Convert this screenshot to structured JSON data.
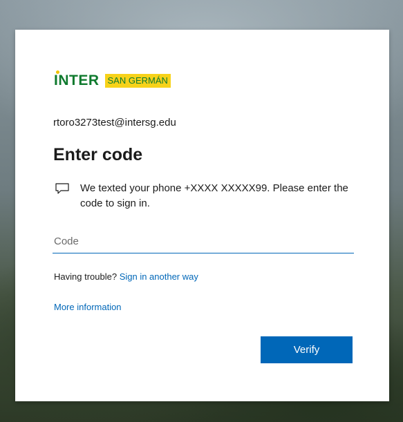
{
  "logo": {
    "brand": "INTER",
    "campus": "SAN GERMÁN"
  },
  "account": {
    "email": "rtoro3273test@intersg.edu"
  },
  "heading": "Enter code",
  "message": {
    "icon": "message-icon",
    "text": "We texted your phone +XXXX XXXXX99. Please enter the code to sign in."
  },
  "code_field": {
    "placeholder": "Code",
    "value": ""
  },
  "trouble": {
    "prefix": "Having trouble?",
    "link": "Sign in another way"
  },
  "more_info": "More information",
  "verify_button": "Verify",
  "colors": {
    "accent": "#0067b8",
    "brand_green": "#0f7a2e",
    "brand_yellow": "#f7d21a"
  }
}
